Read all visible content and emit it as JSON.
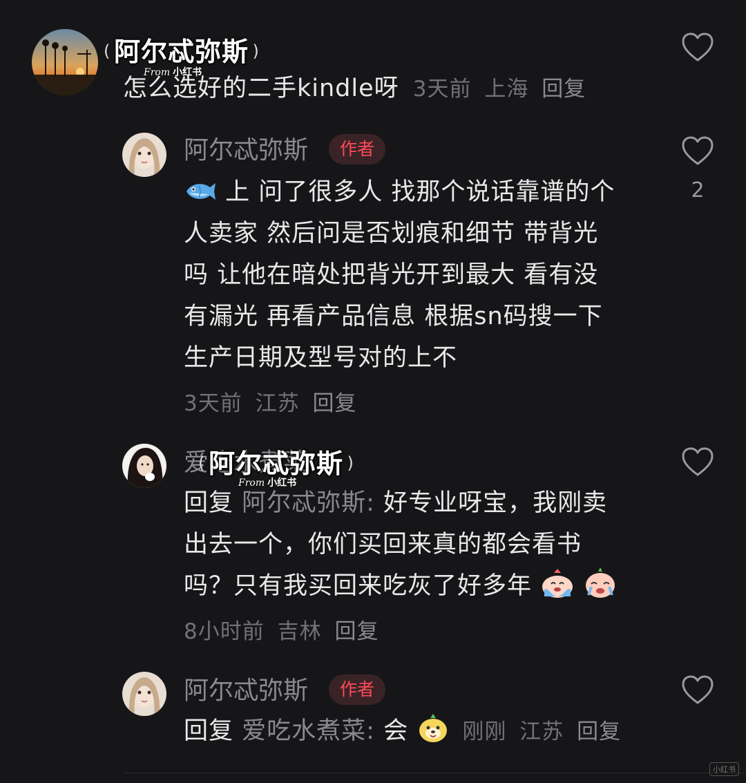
{
  "comments": [
    {
      "username": "阿尔忒弥斯",
      "text": "怎么选好的二手kindle呀",
      "time": "3天前",
      "location": "上海",
      "reply_label": "回复"
    },
    {
      "username": "阿尔忒弥斯",
      "badge": "作者",
      "text_lines": [
        "上 问了很多人 找那个说话靠谱的个",
        "人卖家 然后问是否划痕和细节 带背光",
        "吗 让他在暗处把背光开到最大 看有没",
        "有漏光 再看产品信息 根据sn码搜一下",
        "生产日期及型号对的上不"
      ],
      "time": "3天前",
      "location": "江苏",
      "reply_label": "回复",
      "like_count": "2"
    },
    {
      "username": "爱吃水煮菜",
      "reply_prefix": "回复",
      "reply_to": "阿尔忒弥斯:",
      "text_lines": [
        "好专业呀宝，我刚卖",
        "出去一个，你们买回来真的都会看书",
        "吗？只有我买回来吃灰了好多年"
      ],
      "time": "8小时前",
      "location": "吉林",
      "reply_label": "回复"
    },
    {
      "username": "阿尔忒弥斯",
      "badge": "作者",
      "reply_prefix": "回复",
      "reply_to": "爱吃水煮菜:",
      "text": "会",
      "time": "刚刚",
      "location": "江苏",
      "reply_label": "回复"
    }
  ],
  "watermark": {
    "name": "阿尔忒弥斯",
    "paren_open": "(",
    "paren_close": ")",
    "from": "From",
    "platform": "小红书"
  },
  "corner_logo": "小红书",
  "icons": {
    "like": "heart-outline-icon",
    "fish_emoji": "fish-emoji-icon",
    "cry_emoji": "crying-emoji-icon",
    "dog_emoji": "dog-emoji-icon"
  },
  "colors": {
    "background": "#161618",
    "text": "#e9e9ea",
    "secondary": "#8a8a8e",
    "badge_text": "#ff4a5a",
    "badge_bg": "#3a2326"
  }
}
